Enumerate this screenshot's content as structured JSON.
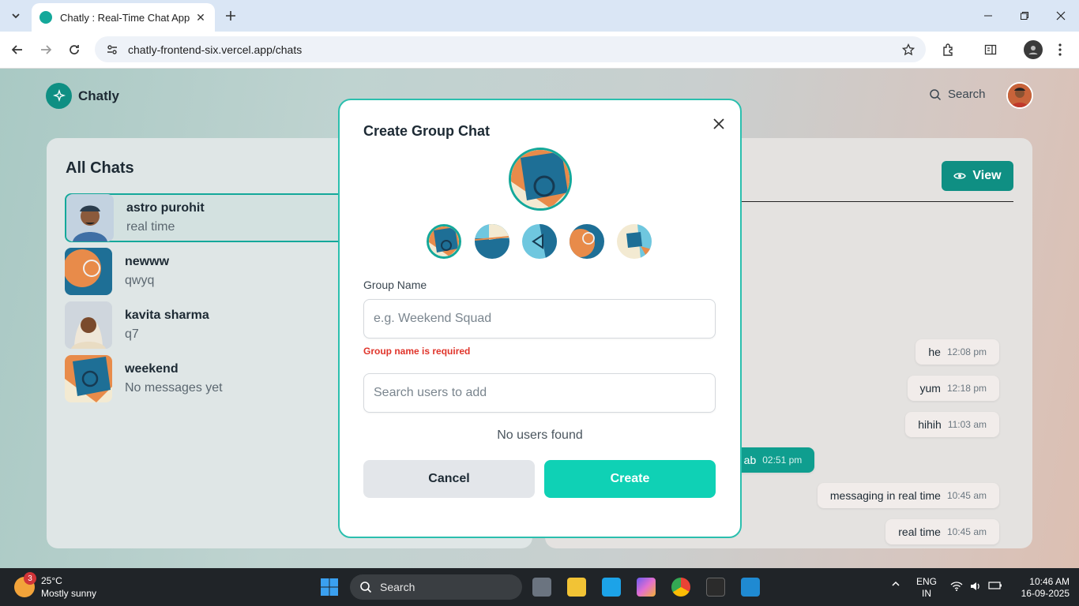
{
  "browser": {
    "tab_title": "Chatly : Real-Time Chat App",
    "url": "chatly-frontend-six.vercel.app/chats"
  },
  "app": {
    "brand": "Chatly",
    "search_label": "Search",
    "left_title": "All Chats",
    "chats": [
      {
        "name": "astro purohit",
        "last": "real time"
      },
      {
        "name": "newww",
        "last": "qwyq"
      },
      {
        "name": "kavita sharma",
        "last": "q7"
      },
      {
        "name": "weekend",
        "last": "No messages yet"
      }
    ],
    "view_label": "View",
    "messages": [
      {
        "text": "he",
        "time": "12:08 pm"
      },
      {
        "text": "yum",
        "time": "12:18 pm"
      },
      {
        "text": "hihih",
        "time": "11:03 am"
      },
      {
        "text": "u ab",
        "time": "02:51 pm"
      },
      {
        "text": "messaging in real time",
        "time": "10:45 am"
      },
      {
        "text": "real time",
        "time": "10:45 am"
      }
    ]
  },
  "modal": {
    "title": "Create Group Chat",
    "group_name_label": "Group Name",
    "group_name_placeholder": "e.g. Weekend Squad",
    "error": "Group name is required",
    "search_placeholder": "Search users to add",
    "no_users": "No users found",
    "cancel_label": "Cancel",
    "create_label": "Create"
  },
  "taskbar": {
    "temp": "25°C",
    "weather": "Mostly sunny",
    "badge": "3",
    "search_label": "Search",
    "lang1": "ENG",
    "lang2": "IN",
    "time": "10:46 AM",
    "date": "16-09-2025"
  },
  "colors": {
    "accent": "#14a89a",
    "create": "#0fd1b5",
    "error": "#e0352b"
  }
}
